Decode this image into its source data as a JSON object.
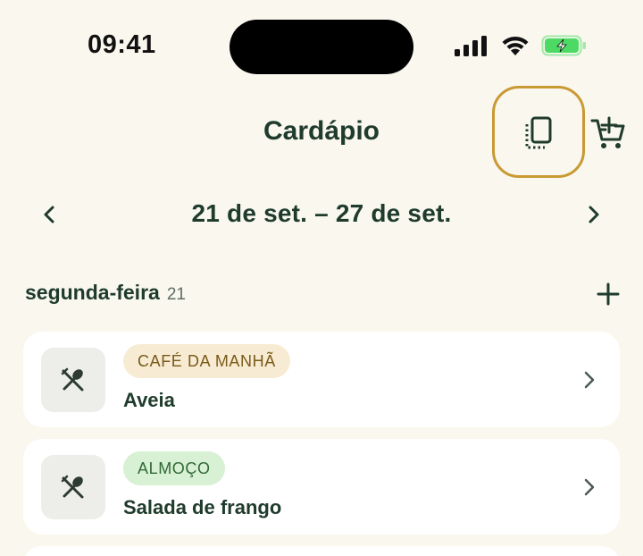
{
  "status_bar": {
    "time": "09:41"
  },
  "header": {
    "title": "Cardápio"
  },
  "week": {
    "range_label": "21 de set. – 27 de set."
  },
  "day": {
    "name": "segunda-feira",
    "number": "21"
  },
  "meals": [
    {
      "tag": "CAFÉ DA MANHÃ",
      "name": "Aveia"
    },
    {
      "tag": "ALMOÇO",
      "name": "Salada de frango"
    }
  ],
  "colors": {
    "background": "#f9f7ee",
    "primary_text": "#1f3b2c",
    "highlight_ring": "#c99a33",
    "battery": "#4cd964",
    "breakfast_tag_bg": "#f7ecd3",
    "lunch_tag_bg": "#d8f0d4"
  },
  "icons": {
    "copy": "copy-menu-icon",
    "cart": "add-to-cart-icon",
    "prev": "chevron-left-icon",
    "next": "chevron-right-icon",
    "add": "plus-icon",
    "meal": "utensils-icon"
  }
}
